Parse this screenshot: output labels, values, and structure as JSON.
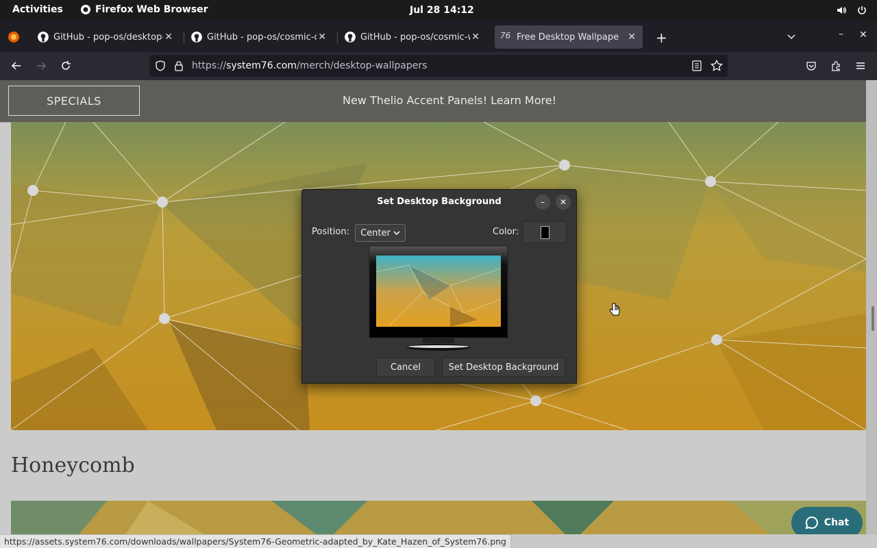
{
  "topbar": {
    "activities": "Activities",
    "app_name": "Firefox Web Browser",
    "clock": "Jul 28  14:12",
    "icons": [
      "volume-icon",
      "power-icon"
    ]
  },
  "tabs": [
    {
      "label": "GitHub - pop-os/desktop-w",
      "icon": "github-icon",
      "active": false
    },
    {
      "label": "GitHub - pop-os/cosmic-do",
      "icon": "github-icon",
      "active": false
    },
    {
      "label": "GitHub - pop-os/cosmic-wo",
      "icon": "github-icon",
      "active": false
    },
    {
      "label": "Free Desktop Wallpapers - S",
      "icon": "system76-icon",
      "active": true
    }
  ],
  "navbar": {
    "url_prefix": "https://",
    "url_host": "system76.com",
    "url_path": "/merch/desktop-wallpapers"
  },
  "page": {
    "specials": "SPECIALS",
    "promo": "New Thelio Accent Panels! Learn More!",
    "section_title": "Honeycomb",
    "chat": "Chat"
  },
  "status_link": "https://assets.system76.com/downloads/wallpapers/System76-Geometric-adapted_by_Kate_Hazen_of_System76.png",
  "dialog": {
    "title": "Set Desktop Background",
    "position_label": "Position:",
    "position_value": "Center",
    "color_label": "Color:",
    "color_value": "#000000",
    "cancel": "Cancel",
    "confirm": "Set Desktop Background"
  }
}
